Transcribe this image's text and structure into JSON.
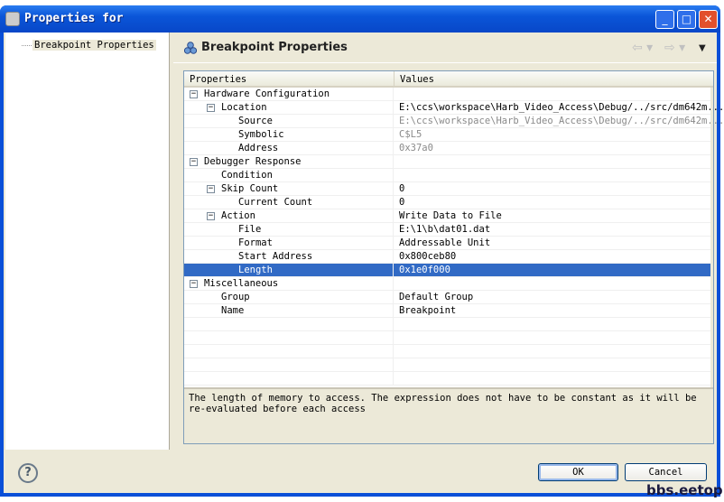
{
  "window": {
    "title": "Properties for",
    "minimize": "_",
    "maximize": "□",
    "close": "✕"
  },
  "sidebar": {
    "items": [
      {
        "label": "Breakpoint Properties"
      }
    ]
  },
  "header": {
    "title": "Breakpoint Properties",
    "back": "⇦ ▾",
    "forward": "⇨ ▾",
    "menu": "▼"
  },
  "table": {
    "columns": [
      "Properties",
      "Values"
    ],
    "rows": [
      {
        "label": "Hardware Configuration",
        "value": "",
        "level": 0,
        "expander": true
      },
      {
        "label": "Location",
        "value": "E:\\ccs\\workspace\\Harb_Video_Access\\Debug/../src/dm642m...",
        "level": 1,
        "expander": true
      },
      {
        "label": "Source",
        "value": "E:\\ccs\\workspace\\Harb_Video_Access\\Debug/../src/dm642m...",
        "level": 2,
        "gray": true
      },
      {
        "label": "Symbolic",
        "value": "C$L5",
        "level": 2,
        "gray": true
      },
      {
        "label": "Address",
        "value": "0x37a0",
        "level": 2,
        "gray": true
      },
      {
        "label": "Debugger Response",
        "value": "",
        "level": 0,
        "expander": true
      },
      {
        "label": "Condition",
        "value": "",
        "level": 1
      },
      {
        "label": "Skip Count",
        "value": "0",
        "level": 1,
        "expander": true
      },
      {
        "label": "Current Count",
        "value": "0",
        "level": 2
      },
      {
        "label": "Action",
        "value": "Write Data to File",
        "level": 1,
        "expander": true
      },
      {
        "label": "File",
        "value": "E:\\1\\b\\dat01.dat",
        "level": 2
      },
      {
        "label": "Format",
        "value": "Addressable Unit",
        "level": 2
      },
      {
        "label": "Start Address",
        "value": "0x800ceb80",
        "level": 2
      },
      {
        "label": "Length",
        "value": "0x1e0f000",
        "level": 2,
        "selected": true
      },
      {
        "label": "Miscellaneous",
        "value": "",
        "level": 0,
        "expander": true
      },
      {
        "label": "Group",
        "value": "Default Group",
        "level": 1
      },
      {
        "label": "Name",
        "value": "Breakpoint",
        "level": 1
      }
    ],
    "empty_rows": 5
  },
  "description": "The length of memory to access.  The expression does not have to be constant as it will be re-evaluated before each access",
  "buttons": {
    "help": "?",
    "ok": "OK",
    "cancel": "Cancel"
  },
  "watermark": "bbs.eetop.cn"
}
